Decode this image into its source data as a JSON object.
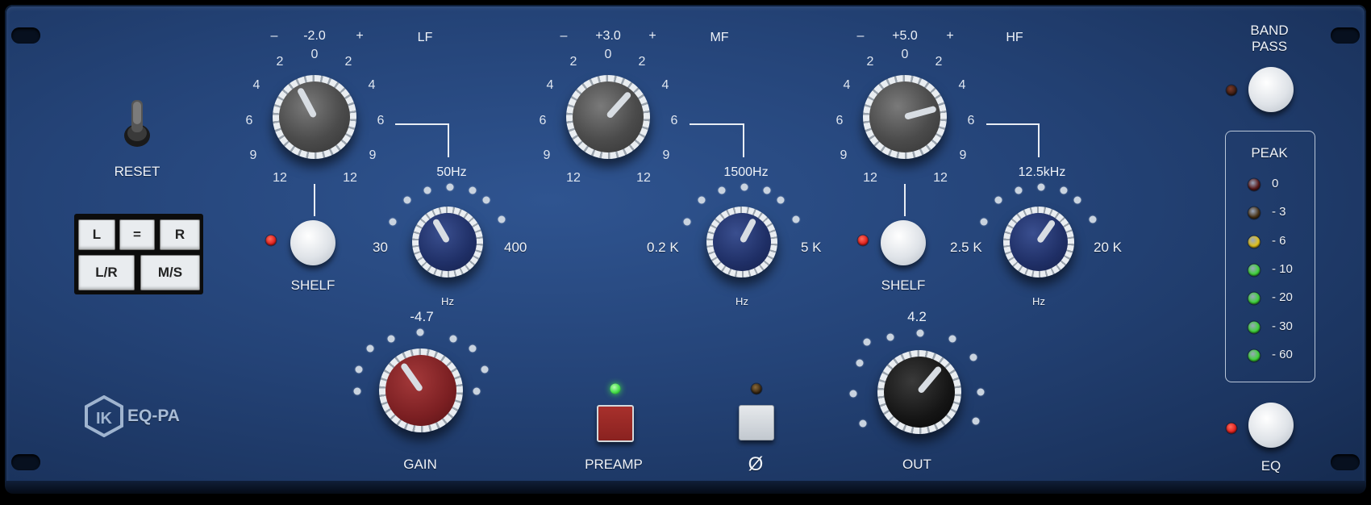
{
  "reset": {
    "label": "RESET"
  },
  "channel": {
    "l": "L",
    "eq": "=",
    "r": "R",
    "lr": "L/R",
    "ms": "M/S"
  },
  "brand": {
    "name": "EQ-PA"
  },
  "scale": {
    "minus": "–",
    "plus": "+",
    "n0": "0",
    "n2": "2",
    "n4": "4",
    "n6": "6",
    "n9": "9",
    "n12": "12"
  },
  "lf": {
    "title": "LF",
    "gain_readout": "-2.0",
    "gain_db": -2.0,
    "freq_readout": "50Hz",
    "freq_min": "30",
    "freq_max": "400",
    "unit": "Hz",
    "shelf_label": "SHELF"
  },
  "mf": {
    "title": "MF",
    "gain_readout": "+3.0",
    "gain_db": 3.0,
    "freq_readout": "1500Hz",
    "freq_min": "0.2 K",
    "freq_max": "5 K",
    "unit": "Hz"
  },
  "hf": {
    "title": "HF",
    "gain_readout": "+5.0",
    "gain_db": 5.0,
    "freq_readout": "12.5kHz",
    "freq_min": "2.5 K",
    "freq_max": "20 K",
    "unit": "Hz",
    "shelf_label": "SHELF"
  },
  "gain": {
    "label": "GAIN",
    "readout": "-4.7"
  },
  "preamp": {
    "label": "PREAMP"
  },
  "phase": {
    "label": "Ø"
  },
  "out": {
    "label": "OUT",
    "readout": "4.2"
  },
  "bandpass": {
    "label1": "BAND",
    "label2": "PASS"
  },
  "eq_button": {
    "label": "EQ"
  },
  "peak": {
    "title": "PEAK",
    "levels": [
      {
        "label": "0",
        "color": "#5a1a1a"
      },
      {
        "label": "- 3",
        "color": "#4a3418"
      },
      {
        "label": "- 6",
        "color": "#e2c21c"
      },
      {
        "label": "- 10",
        "color": "#3fd43a"
      },
      {
        "label": "- 20",
        "color": "#3fd43a"
      },
      {
        "label": "- 30",
        "color": "#3fd43a"
      },
      {
        "label": "- 60",
        "color": "#3fd43a"
      }
    ]
  },
  "colors": {
    "led_red": "#e0201c",
    "led_green": "#46e04a",
    "led_dark": "#3a1c12"
  }
}
